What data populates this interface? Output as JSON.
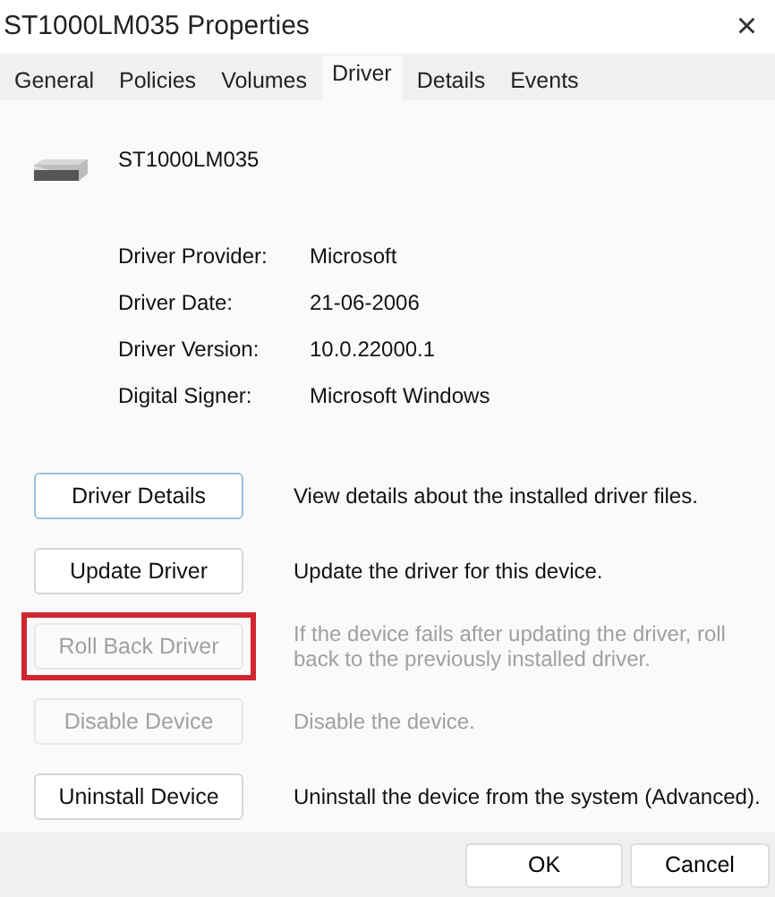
{
  "window": {
    "title": "ST1000LM035 Properties",
    "close": "×"
  },
  "tabs": [
    {
      "label": "General",
      "selected": false
    },
    {
      "label": "Policies",
      "selected": false
    },
    {
      "label": "Volumes",
      "selected": false
    },
    {
      "label": "Driver",
      "selected": true
    },
    {
      "label": "Details",
      "selected": false
    },
    {
      "label": "Events",
      "selected": false
    }
  ],
  "device": {
    "name": "ST1000LM035"
  },
  "properties": [
    {
      "label": "Driver Provider:",
      "value": "Microsoft"
    },
    {
      "label": "Driver Date:",
      "value": "21-06-2006"
    },
    {
      "label": "Driver Version:",
      "value": "10.0.22000.1"
    },
    {
      "label": "Digital Signer:",
      "value": "Microsoft Windows"
    }
  ],
  "actions": [
    {
      "button": "Driver Details",
      "description": "View details about the installed driver files.",
      "disabled": false,
      "focused": true,
      "highlighted": false
    },
    {
      "button": "Update Driver",
      "description": "Update the driver for this device.",
      "disabled": false,
      "focused": false,
      "highlighted": false
    },
    {
      "button": "Roll Back Driver",
      "description": "If the device fails after updating the driver, roll back to the previously installed driver.",
      "disabled": true,
      "focused": false,
      "highlighted": true
    },
    {
      "button": "Disable Device",
      "description": "Disable the device.",
      "disabled": true,
      "focused": false,
      "highlighted": false
    },
    {
      "button": "Uninstall Device",
      "description": "Uninstall the device from the system (Advanced).",
      "disabled": false,
      "focused": false,
      "highlighted": false
    }
  ],
  "footer_buttons": [
    "OK",
    "Cancel"
  ]
}
